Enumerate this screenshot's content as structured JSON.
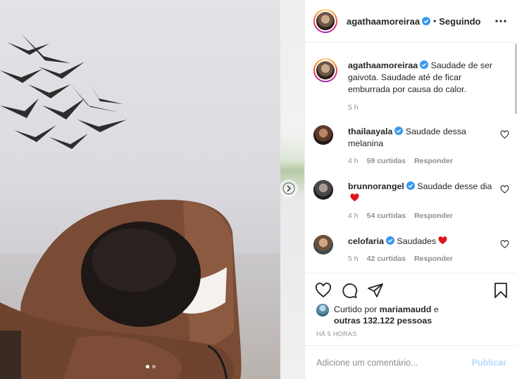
{
  "post": {
    "username": "agathaamoreiraa",
    "follow_separator": "•",
    "follow_status": "Seguindo",
    "caption": "Saudade de ser gaivota. Saudade até de ficar emburrada por causa do calor.",
    "caption_time": "5 h",
    "liked_by_prefix": "Curtido por",
    "liked_by_user": "mariamaudd",
    "liked_by_and": "e",
    "liked_by_others": "outras 132.122 pessoas",
    "time_ago": "HÁ 5 HORAS",
    "carousel_count": 2,
    "carousel_active": 1
  },
  "comments": [
    {
      "username": "thailaayala",
      "text": "Saudade dessa melanina",
      "time": "4 h",
      "likes": "59 curtidas",
      "reply": "Responder",
      "heart": false
    },
    {
      "username": "brunnorangel",
      "text": "Saudade desse dia",
      "time": "4 h",
      "likes": "54 curtidas",
      "reply": "Responder",
      "heart": true
    },
    {
      "username": "celofaria",
      "text": "Saudades",
      "time": "5 h",
      "likes": "42 curtidas",
      "reply": "Responder",
      "heart": true
    }
  ],
  "add_comment": {
    "placeholder": "Adicione um comentário...",
    "submit_label": "Publicar"
  },
  "icons": {
    "verified": "verified-badge-icon",
    "more": "more-options-icon",
    "like": "heart-icon",
    "comment": "comment-icon",
    "share": "paper-plane-icon",
    "save": "bookmark-icon",
    "next": "chevron-right-icon"
  },
  "colors": {
    "verified": "#3897f0",
    "heart_red": "#ed4956",
    "publish_disabled": "#b3dbff",
    "meta_gray": "#8e8e8e"
  }
}
